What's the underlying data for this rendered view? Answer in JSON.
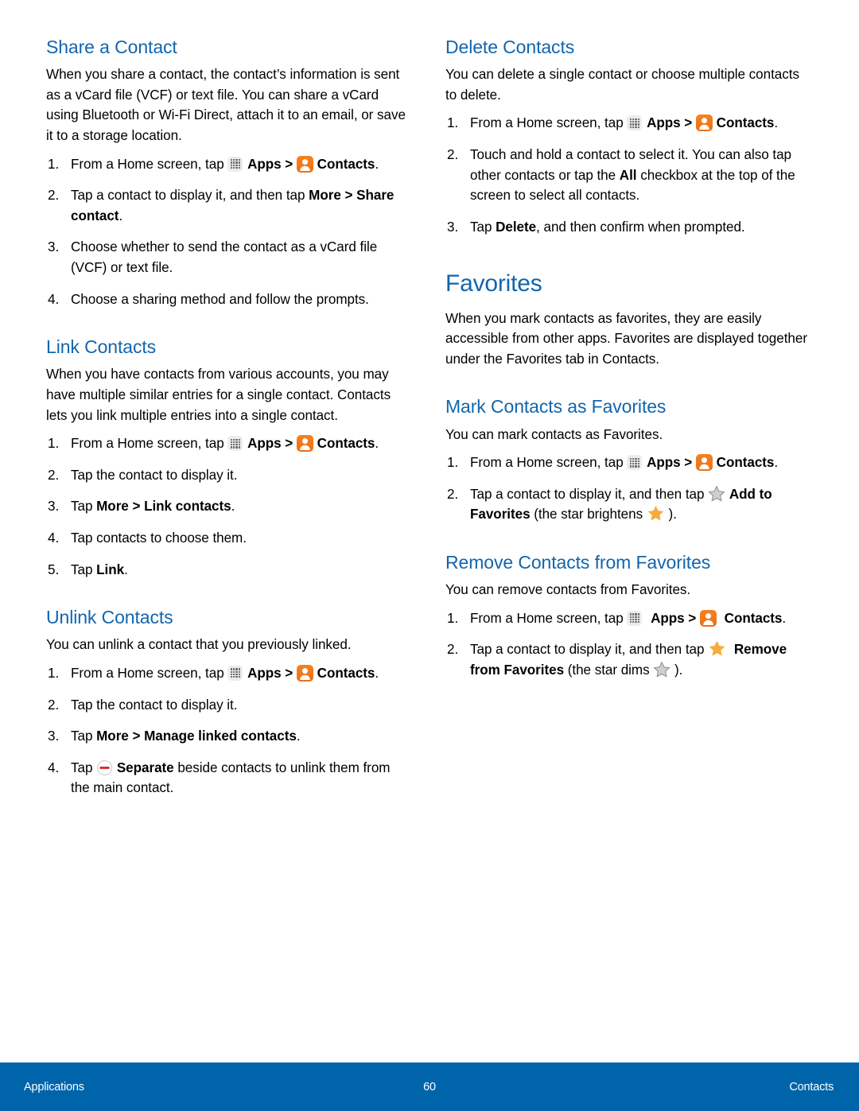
{
  "colors": {
    "heading_blue": "#1265ad",
    "footer_blue": "#0064ab",
    "contacts_icon_orange": "#f07c17",
    "favorite_star_orange": "#f6ab3a",
    "dim_star_gray": "#bfbfbf",
    "separate_red": "#e0252a",
    "body_text": "#000000"
  },
  "icons": {
    "apps": "apps-grid-icon",
    "contacts": "contacts-person-icon",
    "star_dim": "star-dim-icon",
    "star_bright": "star-bright-icon",
    "separate": "separate-minus-icon"
  },
  "left_column": {
    "share_a_contact": {
      "heading": "Share a Contact",
      "intro": "When you share a contact, the contact’s information is sent as a vCard file (VCF) or text file. You can share a vCard using Bluetooth or Wi-Fi Direct, attach it to an email, or save it to a storage location.",
      "steps": [
        {
          "num": "1.",
          "pre": "From a Home screen, tap ",
          "apps_label": "Apps",
          "sep": " > ",
          "contacts_label": "Contacts",
          "post": "."
        },
        {
          "num": "2.",
          "text_a": "Tap a contact to display it, and then tap ",
          "bold_a": "More",
          "text_b": " > ",
          "bold_b": "Share contact",
          "post": "."
        },
        {
          "num": "3.",
          "text": "Choose whether to send the contact as a vCard file (VCF) or text file."
        },
        {
          "num": "4.",
          "text": "Choose a sharing method and follow the prompts."
        }
      ]
    },
    "link_contacts": {
      "heading": "Link Contacts",
      "intro": "When you have contacts from various accounts, you may have multiple similar entries for a single contact. Contacts lets you link multiple entries into a single contact.",
      "steps": [
        {
          "num": "1.",
          "pre": "From a Home screen, tap ",
          "apps_label": "Apps",
          "sep": " > ",
          "contacts_label": "Contacts",
          "post": "."
        },
        {
          "num": "2.",
          "text": "Tap the contact to display it."
        },
        {
          "num": "3.",
          "text_a": "Tap ",
          "bold_a": "More > Link contacts",
          "post": "."
        },
        {
          "num": "4.",
          "text": "Tap contacts to choose them."
        },
        {
          "num": "5.",
          "text_a": "Tap ",
          "bold_a": "Link",
          "post": "."
        }
      ]
    },
    "unlink_contacts": {
      "heading": "Unlink Contacts",
      "intro": "You can unlink a contact that you previously linked.",
      "steps": [
        {
          "num": "1.",
          "pre": "From a Home screen, tap ",
          "apps_label": "Apps",
          "sep": " > ",
          "contacts_label": "Contacts",
          "post": "."
        },
        {
          "num": "2.",
          "text": "Tap the contact to display it."
        },
        {
          "num": "3.",
          "text_a": "Tap ",
          "bold_a": "More > Manage linked contacts",
          "post": "."
        },
        {
          "num": "4.",
          "pre": "Tap ",
          "bold_a": "Separate",
          "post": " beside contacts to unlink them from the main contact."
        }
      ]
    }
  },
  "right_column": {
    "delete_contacts": {
      "heading": "Delete Contacts",
      "intro": "You can delete a single contact or choose multiple contacts to delete.",
      "steps": [
        {
          "num": "1.",
          "pre": "From a Home screen, tap ",
          "apps_label": "Apps",
          "sep": " > ",
          "contacts_label": "Contacts",
          "post": "."
        },
        {
          "num": "2.",
          "text_a": "Touch and hold a contact to select it. You can also tap other contacts or tap the ",
          "bold_a": "All",
          "text_b": " checkbox at the top of the screen to select all contacts."
        },
        {
          "num": "3.",
          "text_a": "Tap ",
          "bold_a": "Delete",
          "text_b": ", and then confirm when prompted."
        }
      ]
    },
    "favorites": {
      "heading": "Favorites",
      "intro": "When you mark contacts as favorites, they are easily accessible from other apps. Favorites are displayed together under the Favorites tab in Contacts."
    },
    "mark_contacts_as_favorites": {
      "heading": "Mark Contacts as Favorites",
      "intro": "You can mark contacts as Favorites.",
      "steps": [
        {
          "num": "1.",
          "pre": "From a Home screen, tap ",
          "apps_label": "Apps",
          "sep": " > ",
          "contacts_label": "Contacts",
          "post": "."
        },
        {
          "num": "2.",
          "pre": "Tap a contact to display it, and then tap ",
          "bold_a": "Add to Favorites",
          "text_b": " (the star brightens ",
          "post": ")."
        }
      ]
    },
    "remove_contacts_from_favorites": {
      "heading": "Remove Contacts from Favorites",
      "intro": "You can remove contacts from Favorites.",
      "steps": [
        {
          "num": "1.",
          "pre": "From a Home screen, tap ",
          "apps_label": "Apps",
          "sep": " > ",
          "contacts_label": "Contacts",
          "post": "."
        },
        {
          "num": "2.",
          "pre": "Tap a contact to display it, and then tap ",
          "bold_a": "Remove from Favorites",
          "text_b": " (the star dims ",
          "post": ")."
        }
      ]
    }
  },
  "footer": {
    "left": "Applications",
    "page_number": "60",
    "right": "Contacts"
  }
}
